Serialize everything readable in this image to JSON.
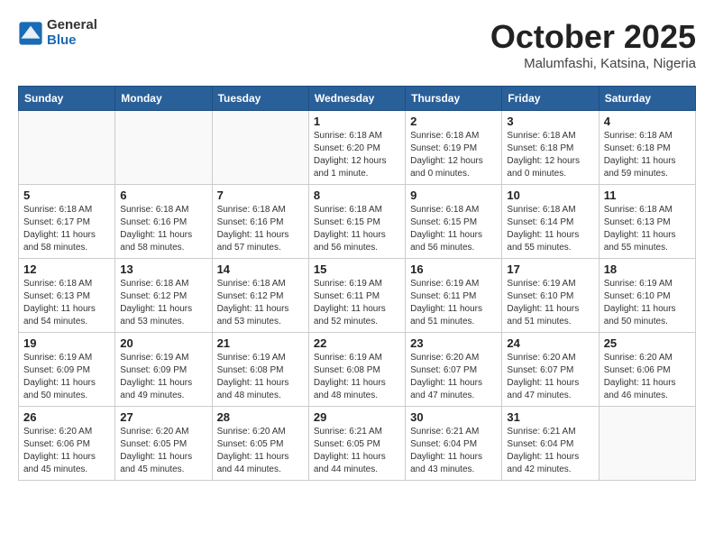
{
  "header": {
    "logo_general": "General",
    "logo_blue": "Blue",
    "month": "October 2025",
    "location": "Malumfashi, Katsina, Nigeria"
  },
  "days_of_week": [
    "Sunday",
    "Monday",
    "Tuesday",
    "Wednesday",
    "Thursday",
    "Friday",
    "Saturday"
  ],
  "weeks": [
    [
      {
        "day": "",
        "info": ""
      },
      {
        "day": "",
        "info": ""
      },
      {
        "day": "",
        "info": ""
      },
      {
        "day": "1",
        "info": "Sunrise: 6:18 AM\nSunset: 6:20 PM\nDaylight: 12 hours\nand 1 minute."
      },
      {
        "day": "2",
        "info": "Sunrise: 6:18 AM\nSunset: 6:19 PM\nDaylight: 12 hours\nand 0 minutes."
      },
      {
        "day": "3",
        "info": "Sunrise: 6:18 AM\nSunset: 6:18 PM\nDaylight: 12 hours\nand 0 minutes."
      },
      {
        "day": "4",
        "info": "Sunrise: 6:18 AM\nSunset: 6:18 PM\nDaylight: 11 hours\nand 59 minutes."
      }
    ],
    [
      {
        "day": "5",
        "info": "Sunrise: 6:18 AM\nSunset: 6:17 PM\nDaylight: 11 hours\nand 58 minutes."
      },
      {
        "day": "6",
        "info": "Sunrise: 6:18 AM\nSunset: 6:16 PM\nDaylight: 11 hours\nand 58 minutes."
      },
      {
        "day": "7",
        "info": "Sunrise: 6:18 AM\nSunset: 6:16 PM\nDaylight: 11 hours\nand 57 minutes."
      },
      {
        "day": "8",
        "info": "Sunrise: 6:18 AM\nSunset: 6:15 PM\nDaylight: 11 hours\nand 56 minutes."
      },
      {
        "day": "9",
        "info": "Sunrise: 6:18 AM\nSunset: 6:15 PM\nDaylight: 11 hours\nand 56 minutes."
      },
      {
        "day": "10",
        "info": "Sunrise: 6:18 AM\nSunset: 6:14 PM\nDaylight: 11 hours\nand 55 minutes."
      },
      {
        "day": "11",
        "info": "Sunrise: 6:18 AM\nSunset: 6:13 PM\nDaylight: 11 hours\nand 55 minutes."
      }
    ],
    [
      {
        "day": "12",
        "info": "Sunrise: 6:18 AM\nSunset: 6:13 PM\nDaylight: 11 hours\nand 54 minutes."
      },
      {
        "day": "13",
        "info": "Sunrise: 6:18 AM\nSunset: 6:12 PM\nDaylight: 11 hours\nand 53 minutes."
      },
      {
        "day": "14",
        "info": "Sunrise: 6:18 AM\nSunset: 6:12 PM\nDaylight: 11 hours\nand 53 minutes."
      },
      {
        "day": "15",
        "info": "Sunrise: 6:19 AM\nSunset: 6:11 PM\nDaylight: 11 hours\nand 52 minutes."
      },
      {
        "day": "16",
        "info": "Sunrise: 6:19 AM\nSunset: 6:11 PM\nDaylight: 11 hours\nand 51 minutes."
      },
      {
        "day": "17",
        "info": "Sunrise: 6:19 AM\nSunset: 6:10 PM\nDaylight: 11 hours\nand 51 minutes."
      },
      {
        "day": "18",
        "info": "Sunrise: 6:19 AM\nSunset: 6:10 PM\nDaylight: 11 hours\nand 50 minutes."
      }
    ],
    [
      {
        "day": "19",
        "info": "Sunrise: 6:19 AM\nSunset: 6:09 PM\nDaylight: 11 hours\nand 50 minutes."
      },
      {
        "day": "20",
        "info": "Sunrise: 6:19 AM\nSunset: 6:09 PM\nDaylight: 11 hours\nand 49 minutes."
      },
      {
        "day": "21",
        "info": "Sunrise: 6:19 AM\nSunset: 6:08 PM\nDaylight: 11 hours\nand 48 minutes."
      },
      {
        "day": "22",
        "info": "Sunrise: 6:19 AM\nSunset: 6:08 PM\nDaylight: 11 hours\nand 48 minutes."
      },
      {
        "day": "23",
        "info": "Sunrise: 6:20 AM\nSunset: 6:07 PM\nDaylight: 11 hours\nand 47 minutes."
      },
      {
        "day": "24",
        "info": "Sunrise: 6:20 AM\nSunset: 6:07 PM\nDaylight: 11 hours\nand 47 minutes."
      },
      {
        "day": "25",
        "info": "Sunrise: 6:20 AM\nSunset: 6:06 PM\nDaylight: 11 hours\nand 46 minutes."
      }
    ],
    [
      {
        "day": "26",
        "info": "Sunrise: 6:20 AM\nSunset: 6:06 PM\nDaylight: 11 hours\nand 45 minutes."
      },
      {
        "day": "27",
        "info": "Sunrise: 6:20 AM\nSunset: 6:05 PM\nDaylight: 11 hours\nand 45 minutes."
      },
      {
        "day": "28",
        "info": "Sunrise: 6:20 AM\nSunset: 6:05 PM\nDaylight: 11 hours\nand 44 minutes."
      },
      {
        "day": "29",
        "info": "Sunrise: 6:21 AM\nSunset: 6:05 PM\nDaylight: 11 hours\nand 44 minutes."
      },
      {
        "day": "30",
        "info": "Sunrise: 6:21 AM\nSunset: 6:04 PM\nDaylight: 11 hours\nand 43 minutes."
      },
      {
        "day": "31",
        "info": "Sunrise: 6:21 AM\nSunset: 6:04 PM\nDaylight: 11 hours\nand 42 minutes."
      },
      {
        "day": "",
        "info": ""
      }
    ]
  ]
}
